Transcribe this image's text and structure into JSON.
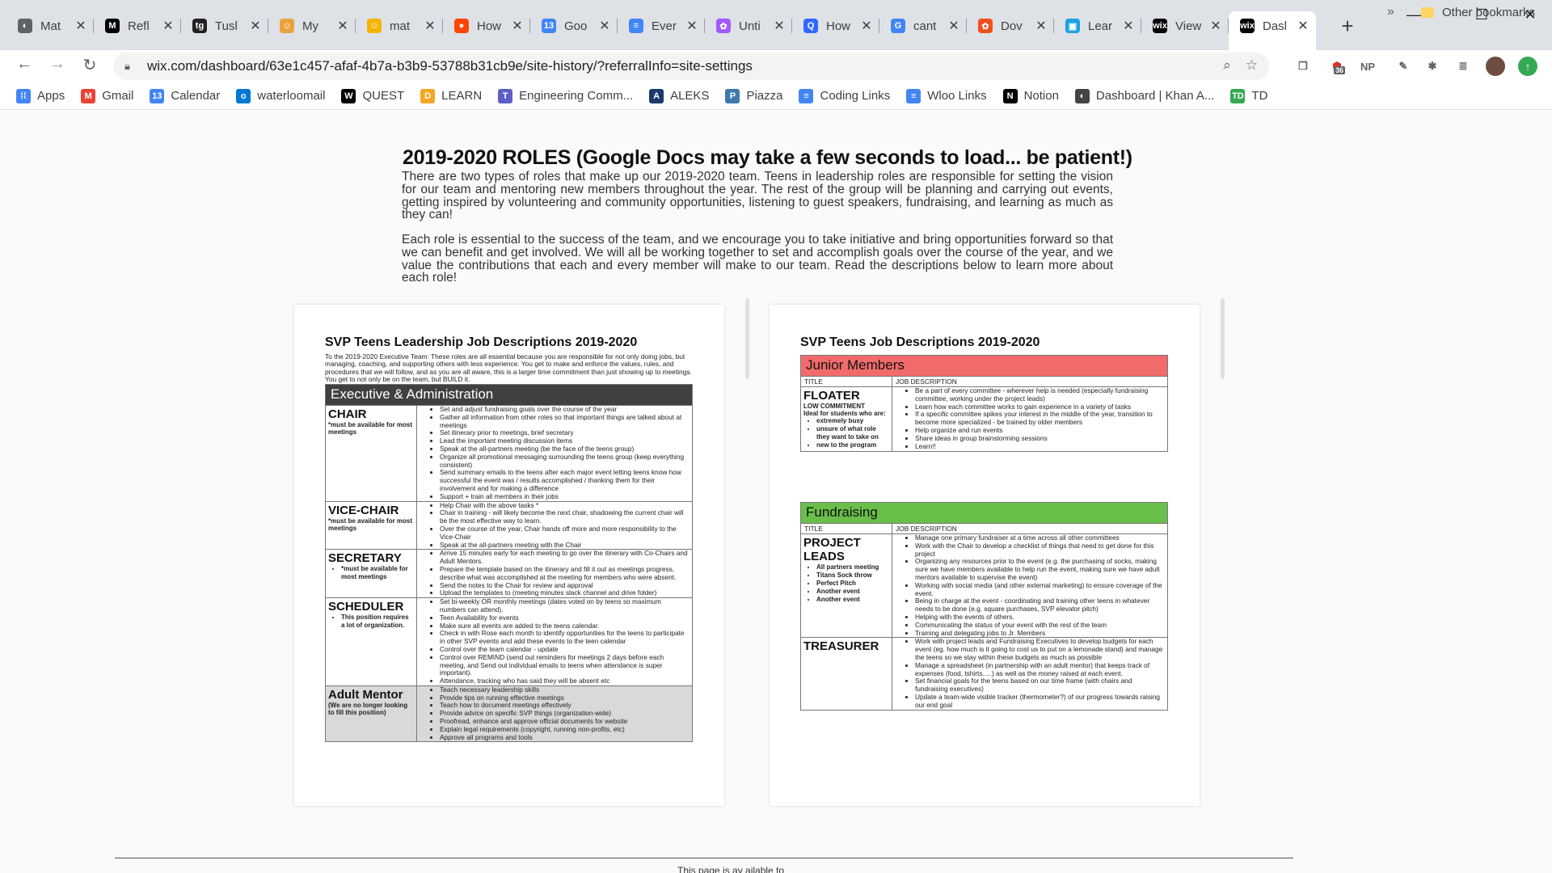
{
  "tabs": [
    {
      "label": "Mat",
      "fav": "◐",
      "color": "#5f6368"
    },
    {
      "label": "Refl",
      "fav": "M",
      "color": "#000000"
    },
    {
      "label": "Tusl",
      "fav": "tg",
      "color": "#222222"
    },
    {
      "label": "My",
      "fav": "☺",
      "color": "#e8a33d"
    },
    {
      "label": "mat",
      "fav": "☺",
      "color": "#f4b400"
    },
    {
      "label": "How",
      "fav": "●",
      "color": "#ff4500"
    },
    {
      "label": "Goo",
      "fav": "13",
      "color": "#4285f4"
    },
    {
      "label": "Ever",
      "fav": "≡",
      "color": "#4285f4"
    },
    {
      "label": "Unti",
      "fav": "✿",
      "color": "#a259ff"
    },
    {
      "label": "How",
      "fav": "Q",
      "color": "#2e69ff"
    },
    {
      "label": "cant",
      "fav": "G",
      "color": "#4285f4"
    },
    {
      "label": "Dov",
      "fav": "✿",
      "color": "#f24e1e"
    },
    {
      "label": "Lear",
      "fav": "▣",
      "color": "#1ba1e2"
    },
    {
      "label": "View",
      "fav": "wix",
      "color": "#000000"
    },
    {
      "label": "Dasl",
      "fav": "wix",
      "color": "#000000"
    }
  ],
  "window": {
    "minimize": "—",
    "maximize": "☐",
    "close": "✕"
  },
  "toolbar": {
    "url": "wix.com/dashboard/63e1c457-afaf-4b7a-b3b9-53788b31cb9e/site-history/?referralInfo=site-settings",
    "ext_badge": "36",
    "ext_np": "NP"
  },
  "bookmarks": [
    {
      "label": "Apps",
      "icon": "apps-icon",
      "color": "#4285f4",
      "glyph": "⁞⁞"
    },
    {
      "label": "Gmail",
      "icon": "gmail-icon",
      "color": "#ea4335",
      "glyph": "M"
    },
    {
      "label": "Calendar",
      "icon": "calendar-icon",
      "color": "#4285f4",
      "glyph": "13"
    },
    {
      "label": "waterloomail",
      "icon": "outlook-icon",
      "color": "#0078d4",
      "glyph": "o"
    },
    {
      "label": "QUEST",
      "icon": "quest-icon",
      "color": "#000000",
      "glyph": "W"
    },
    {
      "label": "LEARN",
      "icon": "learn-icon",
      "color": "#f5a623",
      "glyph": "D"
    },
    {
      "label": "Engineering Comm...",
      "icon": "teams-icon",
      "color": "#5b5fc7",
      "glyph": "T"
    },
    {
      "label": "ALEKS",
      "icon": "aleks-icon",
      "color": "#1a3a6b",
      "glyph": "A"
    },
    {
      "label": "Piazza",
      "icon": "piazza-icon",
      "color": "#3e7aab",
      "glyph": "P"
    },
    {
      "label": "Coding Links",
      "icon": "docs-icon",
      "color": "#4285f4",
      "glyph": "≡"
    },
    {
      "label": "Wloo Links",
      "icon": "docs-icon",
      "color": "#4285f4",
      "glyph": "≡"
    },
    {
      "label": "Notion",
      "icon": "notion-icon",
      "color": "#000000",
      "glyph": "N"
    },
    {
      "label": "Dashboard | Khan A...",
      "icon": "khan-icon",
      "color": "#444444",
      "glyph": "◐"
    },
    {
      "label": "TD",
      "icon": "td-icon",
      "color": "#34a853",
      "glyph": "TD"
    }
  ],
  "bookmarks_more": "»",
  "other_bookmarks": "Other bookmarks",
  "page": {
    "heading": "2019-2020 ROLES (Google Docs may take a few seconds to load... be patient!)",
    "para1": "There are two types of roles that make up our 2019-2020 team. Teens in leadership roles are responsible for setting the vision for our team and mentoring new members throughout the year. The rest of the group will be planning and carrying out events, getting inspired by volunteering and community opportunities, listening to guest speakers, fundraising, and learning as much as they can!",
    "para2": "Each role is essential to the success of the team, and we encourage you to take initiative and bring opportunities forward so that we can benefit and get involved. We will all be working together to set and accomplish goals over the course of the year, and we value the contributions that each and every member will make to our team. Read the descriptions below to learn more about each role!",
    "bottom_text": "This page is av ailable to"
  },
  "leadership_doc": {
    "title": "SVP Teens Leadership Job Descriptions 2019-2020",
    "intro": "To the 2019-2020 Executive Team: These roles are all essential because you are responsible for not only doing jobs, but managing, coaching, and supporting others with less experience. You get to make and enforce the values, rules, and procedures that we will follow, and as you are all aware, this is a larger time commitment than just showing up to meetings. You get to not only be on the team, but BUILD it.",
    "section": "Executive & Administration",
    "section_color": "#404040",
    "roles": [
      {
        "title": "CHAIR",
        "note": "*must be available for most meetings",
        "items": [
          "Set and adjust fundraising goals over the course of the year",
          "Gather all information from other roles so that important things are talked about at meetings",
          "Set itinerary prior to meetings, brief secretary",
          "Lead the important meeting discussion items",
          "Speak at the all-partners meeting (be the face of the teens group)",
          "Organize all promotional messaging surrounding the teens group (keep everything consistent)",
          "Send summary emails to the teens after each major event letting teens know how successful the event was / results accomplished / thanking them for their involvement and for making a difference",
          "Support + train all members in their jobs"
        ]
      },
      {
        "title": "VICE-CHAIR",
        "note": "*must be available for most meetings",
        "items": [
          "Help Chair with the above tasks *",
          "Chair in training - will likely become the next chair, shadowing the current chair will be the most effective way to learn.",
          "Over the course of the year, Chair hands off more and more responsibility to the Vice-Chair",
          "Speak at the all-partners meeting with the Chair"
        ]
      },
      {
        "title": "SECRETARY",
        "bullets": [
          "*must be available for most meetings"
        ],
        "items": [
          "Arrive 15 minutes early for each meeting to go over the itinerary with Co-Chairs and Adult Mentors.",
          "Prepare the template based on the itinerary and fill it out as meetings progress, describe what was accomplished at the meeting for members who were absent.",
          "Send the notes to the Chair for review and approval",
          "Upload the templates to (meeting minutes slack channel and drive folder)"
        ]
      },
      {
        "title": "SCHEDULER",
        "bullets": [
          "This position requires a lot of organization."
        ],
        "items": [
          "Set bi-weekly OR monthly meetings (dates voted on by teens so maximum numbers can attend).",
          "Teen Availability for events",
          "Make sure all events are added to the teens calendar.",
          "Check in with Rose each month to identify opportunities for the teens to participate in other SVP events and add these events to the teen calendar",
          "Control over the team calendar - update",
          "Control over REMIND (send out reminders for meetings 2 days before each meeting, and Send out individual emails to teens when attendance is super important).",
          "Attendance, tracking who has said they will be absent etc"
        ]
      },
      {
        "title": "Adult Mentor",
        "note": "(We are no longer looking to fill this position)",
        "gray": true,
        "items": [
          "Teach necessary leadership skills",
          "Provide tips on running effective meetings",
          "Teach how to document meetings effectively",
          "Provide advice on specific SVP things (organization-wide)",
          "Proofread, enhance and approve official documents for website",
          "Explain legal requirements (copyright, running non-profits, etc)",
          "Approve all programs and tools"
        ]
      }
    ]
  },
  "jobs_doc": {
    "title": "SVP Teens Job Descriptions 2019-2020",
    "col_title": "TITLE",
    "col_desc": "JOB DESCRIPTION",
    "sections": [
      {
        "name": "Junior Members",
        "color": "#f26b6b",
        "roles": [
          {
            "title": "FLOATER",
            "note": "LOW COMMITMENT\nIdeal for students who are:",
            "bullets": [
              "extremely busy",
              "unsure of what role they want to take on",
              "new to the program"
            ],
            "items": [
              "Be a part of every committee - wherever help is needed (especially fundraising committee, working under the project leads)",
              "Learn how each committee works to gain experience in a variety of tasks",
              "If a specific committee spikes your interest in the middle of the year, transition to become more specialized - be trained by older members",
              "Help organize and run events",
              "Share ideas in group brainstorming sessions",
              "Learn!!"
            ]
          }
        ]
      },
      {
        "name": "Fundraising",
        "color": "#6abf4b",
        "roles": [
          {
            "title": "PROJECT LEADS",
            "bullets": [
              "All partners meeting",
              "Titans Sock throw",
              "Perfect Pitch",
              "Another event",
              "Another event"
            ],
            "items": [
              "Manage one primary fundraiser at a time across all other committees",
              "Work with the Chair to develop a checklist of things that need to get done for this project",
              "Organizing any resources prior to the event (e.g. the purchasing of socks, making sure we have members available to help run the event, making sure we have adult mentors available to supervise the event)",
              "Working with social media (and other external marketing) to ensure coverage of the event.",
              "Being in charge at the event - coordinating and training other teens in whatever needs to be done (e.g. square purchases, SVP elevator pitch)",
              "Helping with the events of others.",
              "Communicating the status of your event with the rest of the team",
              "Training and delegating jobs to Jr. Members"
            ]
          },
          {
            "title": "TREASURER",
            "items": [
              "Work with project leads and Fundraising Executives to develop budgets for each event (eg. how much is it going to cost us to put on a lemonade stand) and manage the teens so we stay within these budgets as much as possible",
              "Manage a spreadsheet (in partnership with an adult mentor) that keeps track of expenses (food, tshirts.....) as well as the money raised at each event.",
              "Set financial goals for the teens based on our time frame (with chairs and fundraising executives)",
              "Update a team-wide visible tracker (thermometer?) of our progress towards raising our end goal"
            ]
          }
        ]
      }
    ]
  }
}
